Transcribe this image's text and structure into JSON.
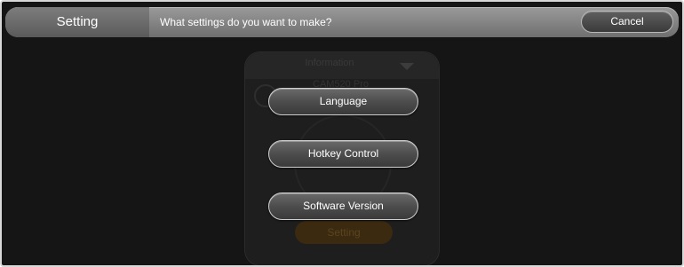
{
  "header": {
    "title": "Setting",
    "prompt": "What settings do you want to make?",
    "cancel_label": "Cancel"
  },
  "background_panel": {
    "info_label": "Information",
    "model_label": "CAM520 Pro",
    "setting_label": "Setting"
  },
  "options": [
    {
      "label": "Language"
    },
    {
      "label": "Hotkey Control"
    },
    {
      "label": "Software Version"
    }
  ]
}
